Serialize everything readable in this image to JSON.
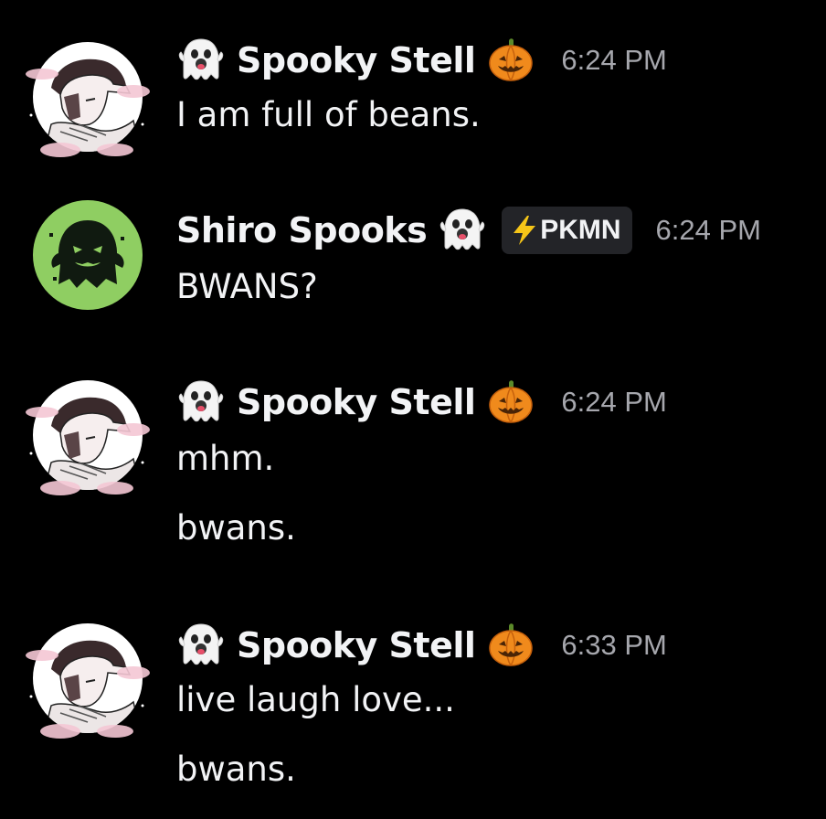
{
  "messages": [
    {
      "username": "Spooky Stell",
      "timestamp": "6:24 PM",
      "lines": [
        "I am full of beans."
      ]
    },
    {
      "username": "Shiro Spooks",
      "timestamp": "6:24 PM",
      "tag": "PKMN",
      "lines": [
        "BWANS?"
      ]
    },
    {
      "username": "Spooky Stell",
      "timestamp": "6:24 PM",
      "lines": [
        "mhm.",
        "bwans."
      ]
    },
    {
      "username": "Spooky Stell",
      "timestamp": "6:33 PM",
      "lines": [
        "live laugh love...",
        "bwans."
      ]
    }
  ],
  "icons": {
    "ghost": "ghost-emoji-icon",
    "pumpkin": "jack-o-lantern-emoji-icon",
    "bolt": "lightning-bolt-icon"
  },
  "colors": {
    "background": "#000000",
    "text": "#f2f3f5",
    "timestamp": "#a6a7ad",
    "tag_bg": "#232428",
    "shiro_avatar_bg": "#8fce62",
    "bolt": "#f5c518",
    "pumpkin": "#f08a1c"
  }
}
